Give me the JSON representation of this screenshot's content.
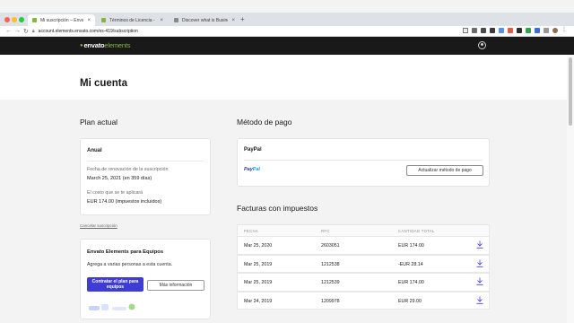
{
  "browser": {
    "tabs": [
      {
        "title": "Mi suscripción – Envato Eleme",
        "active": true,
        "favicon_color": "#82b541"
      },
      {
        "title": "Términos de Licencia - Envato",
        "active": false,
        "favicon_color": "#82b541"
      },
      {
        "title": "Discover what is Business Act",
        "active": false,
        "favicon_color": "#888888"
      }
    ],
    "new_tab": "+",
    "url": "account.elements.envato.com/es-419/subscription"
  },
  "site": {
    "logo_part1": "envato",
    "logo_part2": "elements"
  },
  "page": {
    "title": "Mi cuenta"
  },
  "plan": {
    "section_title": "Plan actual",
    "name": "Anual",
    "renewal_label": "Fecha de renovación de la suscripción",
    "renewal_value": "March 25, 2021 (en 359 días)",
    "cost_label": "El costo que se te aplicará",
    "cost_value": "EUR 174.00 (impuestos incluidos)",
    "cancel_link": "Cancelar suscripción"
  },
  "teams": {
    "title": "Envato Elements para Equipos",
    "description": "Agrega a varias personas a esta cuenta.",
    "primary_button": "Contratar el plan para equipos",
    "secondary_button": "Más información"
  },
  "payment": {
    "section_title": "Método de pago",
    "method": "PayPal",
    "logo_part1": "Pay",
    "logo_part2": "Pal",
    "update_button": "Actualizar método de pago"
  },
  "invoices": {
    "section_title": "Facturas con impuestos",
    "headers": [
      "FECHA",
      "RFC",
      "CANTIDAD TOTAL"
    ],
    "rows": [
      {
        "date": "Mar 25, 2020",
        "rfc": "2603051",
        "amount": "EUR 174.00"
      },
      {
        "date": "Mar 25, 2019",
        "rfc": "1212538",
        "amount": "-EUR 28.14"
      },
      {
        "date": "Mar 25, 2019",
        "rfc": "1212539",
        "amount": "EUR 174.00"
      },
      {
        "date": "Mar 24, 2019",
        "rfc": "1209978",
        "amount": "EUR 29.00"
      }
    ]
  },
  "colors": {
    "header_bg": "#191919",
    "brand_green": "#82b541",
    "primary_button": "#3f3bd6"
  }
}
